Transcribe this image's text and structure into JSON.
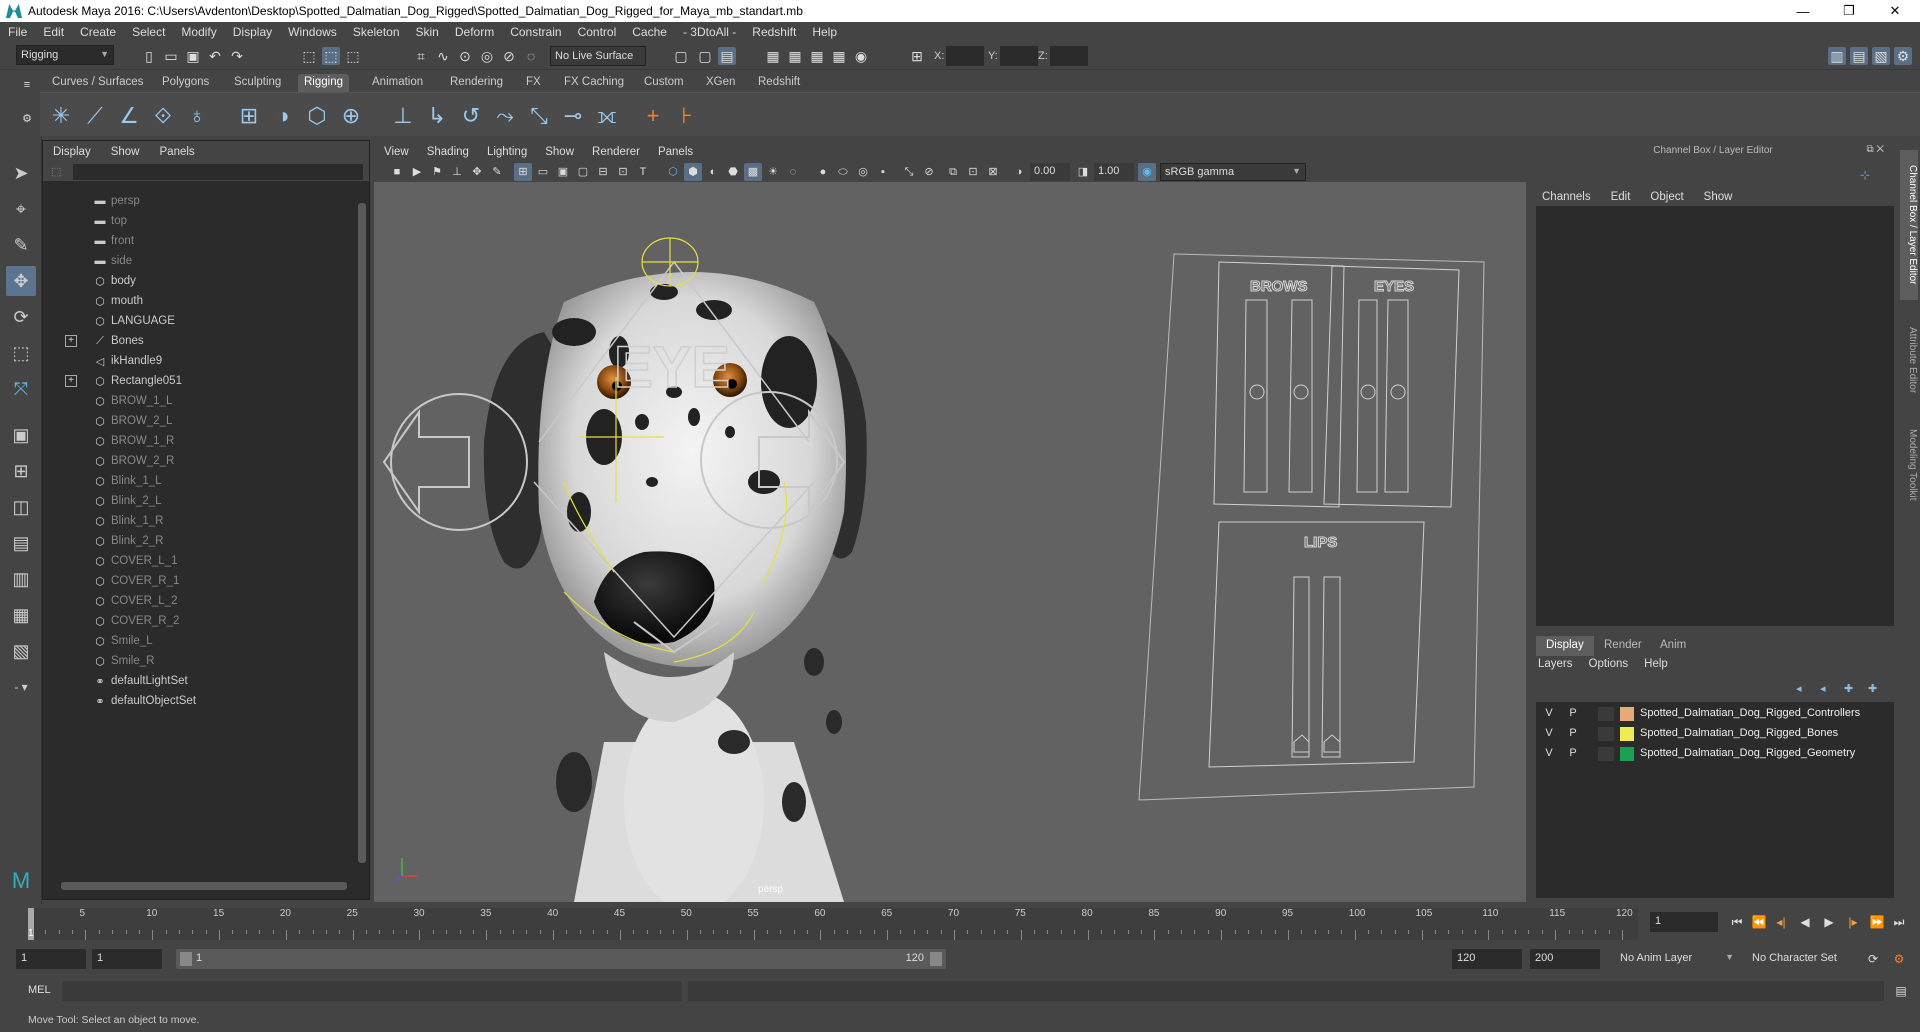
{
  "title": "Autodesk Maya 2016: C:\\Users\\Avdenton\\Desktop\\Spotted_Dalmatian_Dog_Rigged\\Spotted_Dalmatian_Dog_Rigged_for_Maya_mb_standart.mb",
  "window_controls": {
    "minimize": "—",
    "maximize": "❐",
    "close": "✕"
  },
  "menubar": [
    "File",
    "Edit",
    "Create",
    "Select",
    "Modify",
    "Display",
    "Windows",
    "Skeleton",
    "Skin",
    "Deform",
    "Constrain",
    "Control",
    "Cache",
    "- 3DtoAll -",
    "Redshift",
    "Help"
  ],
  "toolbar": {
    "menuset": "Rigging",
    "live_surface": "No Live Surface",
    "x_label": "X:",
    "y_label": "Y:",
    "z_label": "Z:"
  },
  "shelf_tabs": [
    "Curves / Surfaces",
    "Polygons",
    "Sculpting",
    "Rigging",
    "Animation",
    "Rendering",
    "FX",
    "FX Caching",
    "Custom",
    "XGen",
    "Redshift"
  ],
  "shelf_active": "Rigging",
  "outliner": {
    "menu": [
      "Display",
      "Show",
      "Panels"
    ],
    "items": [
      {
        "label": "persp",
        "icon": "camera-icon",
        "dim": true,
        "expand": ""
      },
      {
        "label": "top",
        "icon": "camera-icon",
        "dim": true,
        "expand": ""
      },
      {
        "label": "front",
        "icon": "camera-icon",
        "dim": true,
        "expand": ""
      },
      {
        "label": "side",
        "icon": "camera-icon",
        "dim": true,
        "expand": ""
      },
      {
        "label": "body",
        "icon": "transform-icon",
        "dim": false,
        "expand": ""
      },
      {
        "label": "mouth",
        "icon": "transform-icon",
        "dim": false,
        "expand": ""
      },
      {
        "label": "LANGUAGE",
        "icon": "transform-icon",
        "dim": false,
        "expand": ""
      },
      {
        "label": "Bones",
        "icon": "joint-icon",
        "dim": false,
        "expand": "+"
      },
      {
        "label": "ikHandle9",
        "icon": "ik-handle-icon",
        "dim": false,
        "expand": ""
      },
      {
        "label": "Rectangle051",
        "icon": "transform-icon",
        "dim": false,
        "expand": "+"
      },
      {
        "label": "BROW_1_L",
        "icon": "transform-icon",
        "dim": true,
        "expand": ""
      },
      {
        "label": "BROW_2_L",
        "icon": "transform-icon",
        "dim": true,
        "expand": ""
      },
      {
        "label": "BROW_1_R",
        "icon": "transform-icon",
        "dim": true,
        "expand": ""
      },
      {
        "label": "BROW_2_R",
        "icon": "transform-icon",
        "dim": true,
        "expand": ""
      },
      {
        "label": "Blink_1_L",
        "icon": "transform-icon",
        "dim": true,
        "expand": ""
      },
      {
        "label": "Blink_2_L",
        "icon": "transform-icon",
        "dim": true,
        "expand": ""
      },
      {
        "label": "Blink_1_R",
        "icon": "transform-icon",
        "dim": true,
        "expand": ""
      },
      {
        "label": "Blink_2_R",
        "icon": "transform-icon",
        "dim": true,
        "expand": ""
      },
      {
        "label": "COVER_L_1",
        "icon": "transform-icon",
        "dim": true,
        "expand": ""
      },
      {
        "label": "COVER_R_1",
        "icon": "transform-icon",
        "dim": true,
        "expand": ""
      },
      {
        "label": "COVER_L_2",
        "icon": "transform-icon",
        "dim": true,
        "expand": ""
      },
      {
        "label": "COVER_R_2",
        "icon": "transform-icon",
        "dim": true,
        "expand": ""
      },
      {
        "label": "Smile_L",
        "icon": "transform-icon",
        "dim": true,
        "expand": ""
      },
      {
        "label": "Smile_R",
        "icon": "transform-icon",
        "dim": true,
        "expand": ""
      },
      {
        "label": "defaultLightSet",
        "icon": "set-icon",
        "dim": false,
        "expand": ""
      },
      {
        "label": "defaultObjectSet",
        "icon": "set-icon",
        "dim": false,
        "expand": ""
      }
    ]
  },
  "viewport": {
    "menu": [
      "View",
      "Shading",
      "Lighting",
      "Show",
      "Renderer",
      "Panels"
    ],
    "exposure": "0.00",
    "gamma": "1.00",
    "color_space": "sRGB gamma",
    "camera_label": "persp",
    "face_labels": {
      "eye": "EYE",
      "brows": "BROWS",
      "eyes": "EYES",
      "lips": "LIPS"
    }
  },
  "channel_box": {
    "header": "Channel Box / Layer Editor",
    "menu": [
      "Channels",
      "Edit",
      "Object",
      "Show"
    ]
  },
  "side_tabs": [
    "Channel Box / Layer Editor",
    "Attribute Editor",
    "Modeling Toolkit"
  ],
  "layer_editor": {
    "tabs": [
      "Display",
      "Render",
      "Anim"
    ],
    "active_tab": "Display",
    "menu": [
      "Layers",
      "Options",
      "Help"
    ],
    "layers": [
      {
        "v": "V",
        "p": "P",
        "color": "#e8a878",
        "name": "Spotted_Dalmatian_Dog_Rigged_Controllers"
      },
      {
        "v": "V",
        "p": "P",
        "color": "#f0ec50",
        "name": "Spotted_Dalmatian_Dog_Rigged_Bones"
      },
      {
        "v": "V",
        "p": "P",
        "color": "#1aa050",
        "name": "Spotted_Dalmatian_Dog_Rigged_Geometry"
      }
    ]
  },
  "timeline": {
    "ticks": [
      "5",
      "10",
      "15",
      "20",
      "25",
      "30",
      "35",
      "40",
      "45",
      "50",
      "55",
      "60",
      "65",
      "70",
      "75",
      "80",
      "85",
      "90",
      "95",
      "100",
      "105",
      "110",
      "115",
      "120"
    ],
    "start_marker": "1",
    "current_frame": "1"
  },
  "range": {
    "start": "1",
    "playback_start": "1",
    "slider_start": "1",
    "slider_end": "120",
    "playback_end": "120",
    "end": "200",
    "anim_layer": "No Anim Layer",
    "character_set": "No Character Set"
  },
  "mel_label": "MEL",
  "status_text": "Move Tool: Select an object to move."
}
